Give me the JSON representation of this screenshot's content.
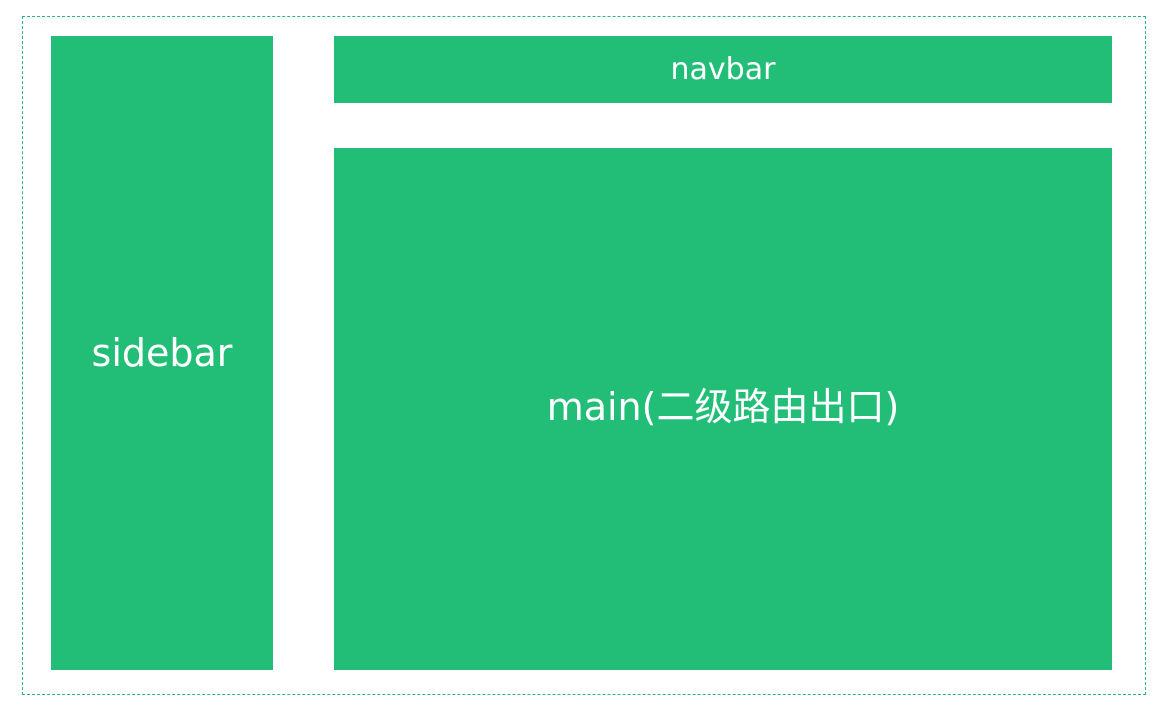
{
  "layout": {
    "sidebar_label": "sidebar",
    "navbar_label": "navbar",
    "main_label": "main(二级路由出口)"
  },
  "colors": {
    "block": "#22be78",
    "frame_border": "#2fb67c",
    "text": "#ffffff"
  }
}
